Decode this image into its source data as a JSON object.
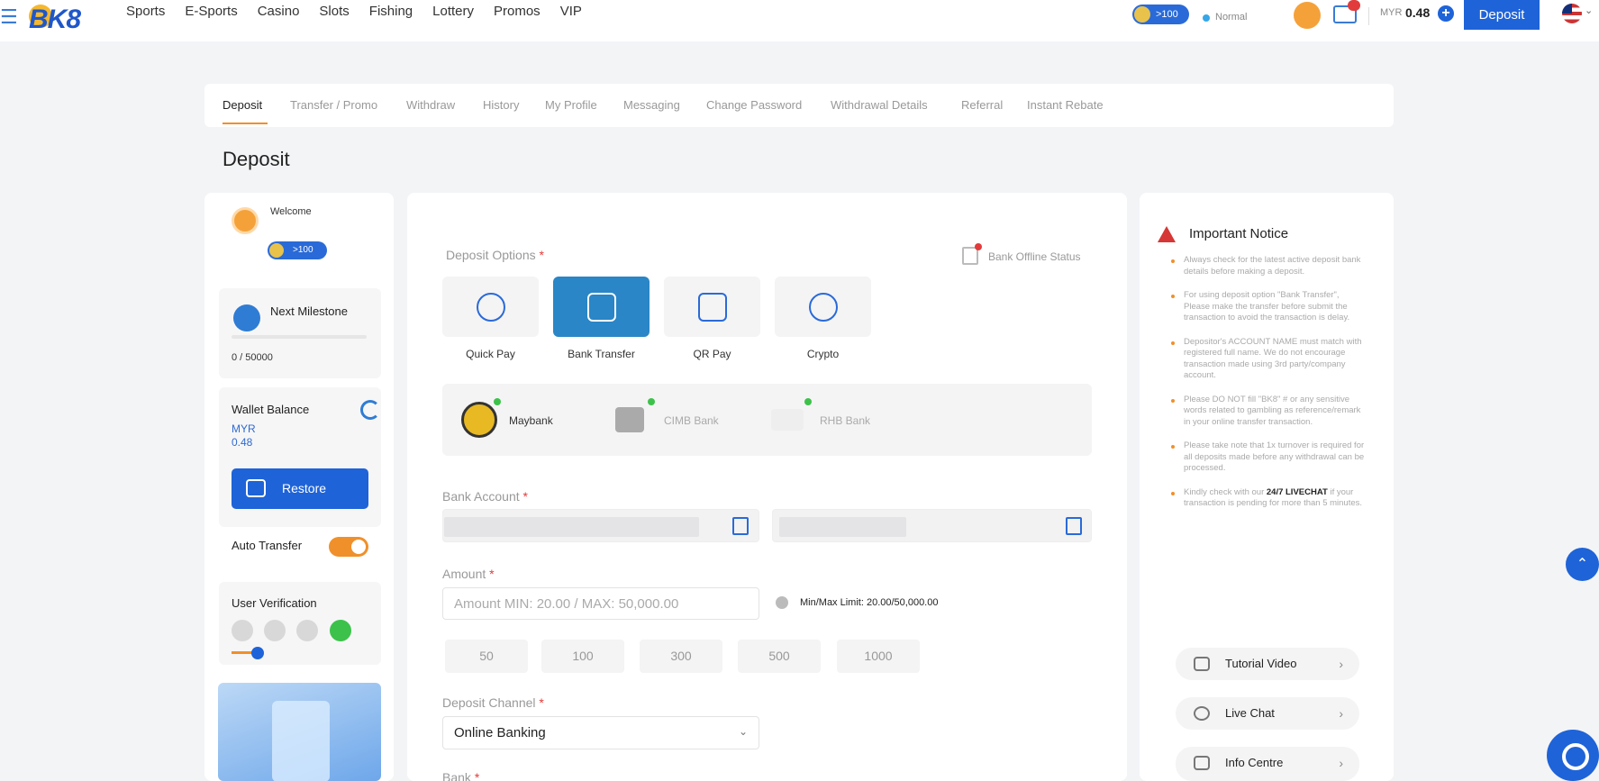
{
  "header": {
    "logo": "BK8",
    "nav": [
      "Sports",
      "E-Sports",
      "Casino",
      "Slots",
      "Fishing",
      "Lottery",
      "Promos",
      "VIP"
    ],
    "vip_points": ">100",
    "status": "Normal",
    "currency": "MYR",
    "balance": "0.48",
    "deposit_label": "Deposit"
  },
  "tabs": [
    "Deposit",
    "Transfer / Promo",
    "Withdraw",
    "History",
    "My Profile",
    "Messaging",
    "Change Password",
    "Withdrawal Details",
    "Referral",
    "Instant Rebate"
  ],
  "page_title": "Deposit",
  "sidebar": {
    "welcome": "Welcome",
    "vip_points": ">100",
    "milestone_title": "Next Milestone",
    "milestone_value": "0 / 50000",
    "wallet_title": "Wallet Balance",
    "wallet_currency": "MYR",
    "wallet_amount": "0.48",
    "restore_label": "Restore",
    "auto_transfer_label": "Auto Transfer",
    "user_verification_label": "User Verification"
  },
  "deposit": {
    "options_label": "Deposit Options",
    "bank_offline_status": "Bank Offline Status",
    "options": [
      {
        "label": "Quick Pay",
        "icon": "quick-pay-icon"
      },
      {
        "label": "Bank Transfer",
        "icon": "bank-transfer-icon"
      },
      {
        "label": "QR Pay",
        "icon": "qr-code-icon"
      },
      {
        "label": "Crypto",
        "icon": "crypto-icon"
      }
    ],
    "banks": [
      "Maybank",
      "CIMB Bank",
      "RHB Bank"
    ],
    "bank_account_label": "Bank Account",
    "amount_label": "Amount",
    "amount_placeholder": "Amount MIN: 20.00 / MAX: 50,000.00",
    "limit_text": "Min/Max Limit: 20.00/50,000.00",
    "quick_amounts": [
      "50",
      "100",
      "300",
      "500",
      "1000"
    ],
    "channel_label": "Deposit Channel",
    "channel_value": "Online Banking",
    "bank_label": "Bank"
  },
  "notice": {
    "title": "Important Notice",
    "items": [
      "Always check for the latest active deposit bank details before making a deposit.",
      "For using deposit option \"Bank Transfer\", Please make the transfer before submit the transaction to avoid the transaction is delay.",
      "Depositor's ACCOUNT NAME must match with registered full name. We do not encourage transaction made using 3rd party/company account.",
      "Please DO NOT fill \"BK8\" # or any sensitive words related to gambling as reference/remark in your online transfer transaction.",
      "Please take note that 1x turnover is required for all deposits made before any withdrawal can be processed."
    ],
    "last_item_prefix": "Kindly check with our ",
    "last_item_link": "24/7 LIVECHAT",
    "last_item_suffix": " if your transaction is pending for more than 5 minutes."
  },
  "help": [
    "Tutorial Video",
    "Live Chat",
    "Info Centre"
  ],
  "colors": {
    "primary": "#1e63d8",
    "accent": "#f0902a",
    "active_option": "#2a86c6"
  }
}
